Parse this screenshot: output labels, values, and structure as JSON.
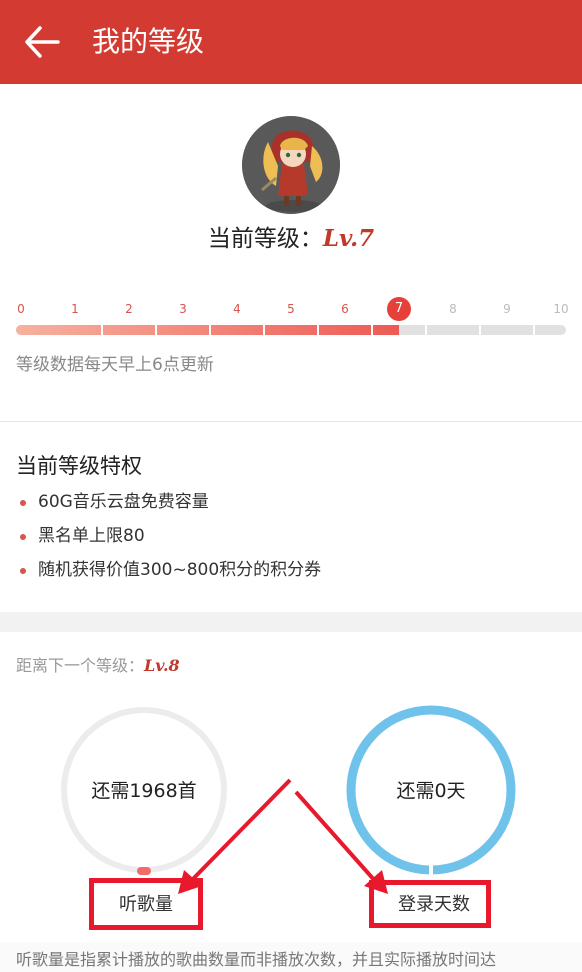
{
  "header": {
    "title": "我的等级",
    "back_icon": "back-arrow-icon"
  },
  "profile": {
    "current_level_label": "当前等级：",
    "current_level_value": "Lv.7"
  },
  "level_bar": {
    "ticks": [
      "0",
      "1",
      "2",
      "3",
      "4",
      "5",
      "6",
      "7",
      "8",
      "9",
      "10"
    ],
    "current": 7,
    "max": 10,
    "note": "等级数据每天早上6点更新"
  },
  "privileges": {
    "title": "当前等级特权",
    "items": [
      "60G音乐云盘免费容量",
      "黑名单上限80",
      "随机获得价值300~800积分的积分券"
    ]
  },
  "next_level": {
    "label": "距离下一个等级：",
    "value": "Lv.8",
    "listen": {
      "text": "还需1968首",
      "caption": "听歌量",
      "progress": 0.0
    },
    "login": {
      "text": "还需0天",
      "caption": "登录天数",
      "progress": 1.0
    }
  },
  "footer": {
    "note": "听歌量是指累计播放的歌曲数量而非播放次数，并且实际播放时间达"
  },
  "colors": {
    "header": "#d33a31",
    "accent": "#e5413a",
    "ring_complete": "#6fc2ea",
    "ring_empty": "#ececec",
    "annotation": "#e8192c"
  }
}
